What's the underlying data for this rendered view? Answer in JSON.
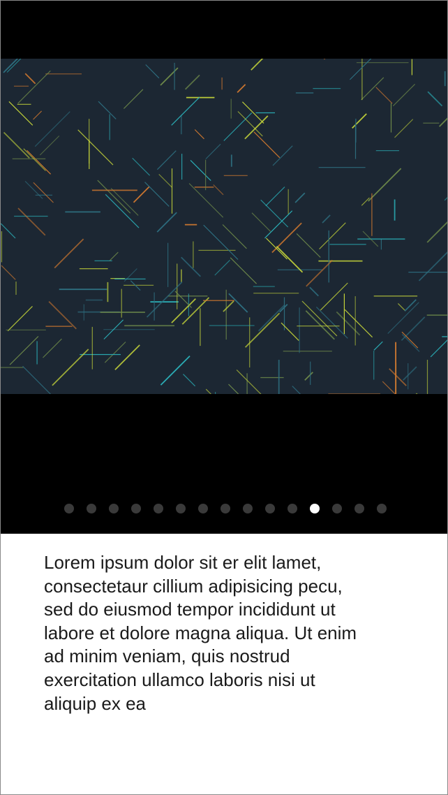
{
  "carousel": {
    "slide_count": 15,
    "active_index": 11,
    "image": {
      "background": "#1c2733",
      "line_colors": [
        "#c8d83a",
        "#2bb0b8",
        "#d2792f",
        "#6e8a4a",
        "#2e6f80"
      ]
    },
    "pager_colors": {
      "inactive": "#3a3a3a",
      "active": "#ffffff"
    }
  },
  "caption": {
    "text": "Lorem ipsum dolor sit er elit lamet, consectetaur cillium adipisicing pecu, sed do eiusmod tempor incididunt ut labore et dolore magna aliqua. Ut enim ad minim veniam, quis nostrud exercitation ullamco laboris nisi ut aliquip ex ea"
  }
}
